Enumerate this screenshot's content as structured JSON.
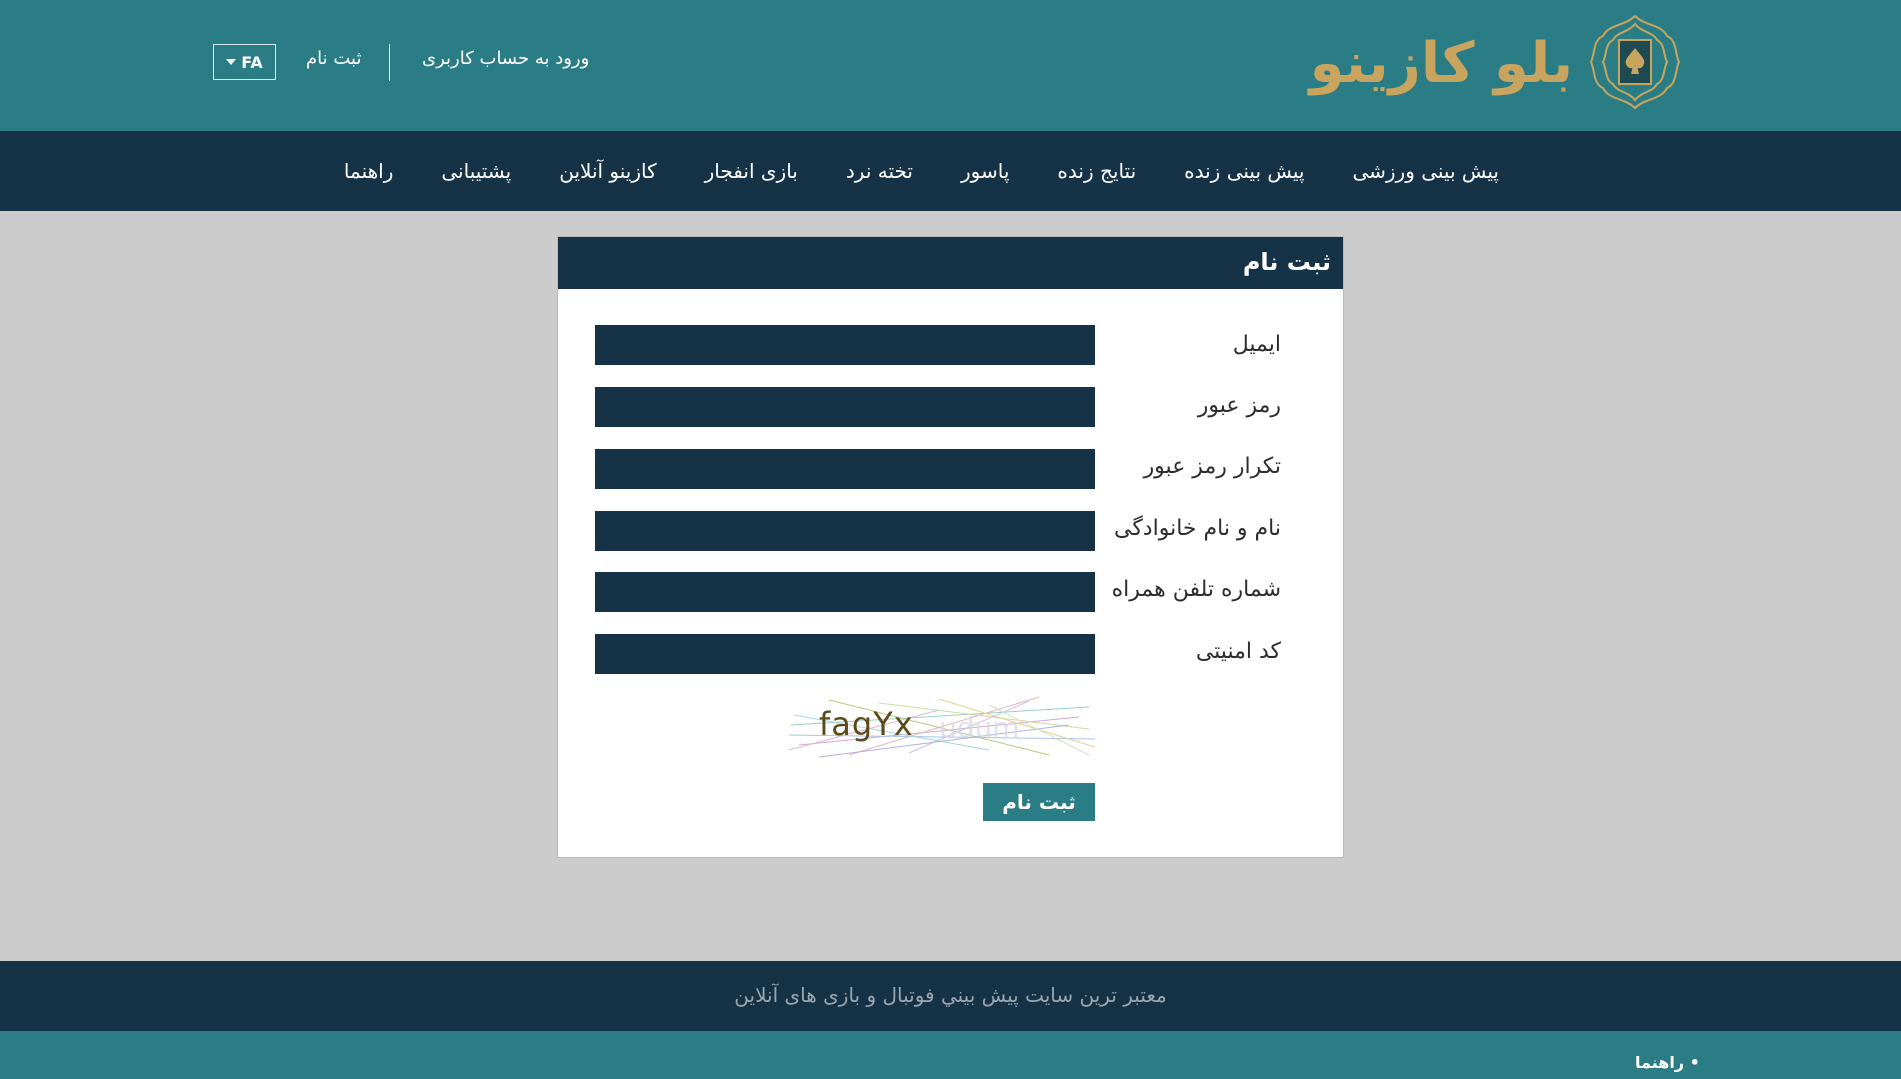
{
  "header": {
    "logo_text": "بلو کازینو",
    "language": "FA",
    "register_link": "ثبت نام",
    "login_link": "ورود به حساب کاربری"
  },
  "nav": {
    "items": [
      "پیش بینی ورزشی",
      "پیش بینی زنده",
      "نتایج زنده",
      "پاسور",
      "تخته نرد",
      "بازی انفجار",
      "کازینو آنلاین",
      "پشتیبانی",
      "راهنما"
    ]
  },
  "form": {
    "title": "ثبت نام",
    "fields": [
      {
        "label": "ایمیل",
        "value": ""
      },
      {
        "label": "رمز عبور",
        "value": ""
      },
      {
        "label": "تکرار رمز عبور",
        "value": ""
      },
      {
        "label": "نام و نام خانوادگی",
        "value": ""
      },
      {
        "label": "شماره تلفن همراه",
        "value": ""
      },
      {
        "label": "کد امنیتی",
        "value": ""
      }
    ],
    "captcha_text": "fagYx",
    "submit_label": "ثبت نام"
  },
  "footer": {
    "tagline": "معتبر ترین سایت پیش بيني فوتبال و بازی های آنلاین",
    "help_link": "• راهنما"
  },
  "colors": {
    "teal": "#2a7d85",
    "navy": "#163247",
    "gold": "#c9a45f",
    "background": "#cccccc"
  }
}
